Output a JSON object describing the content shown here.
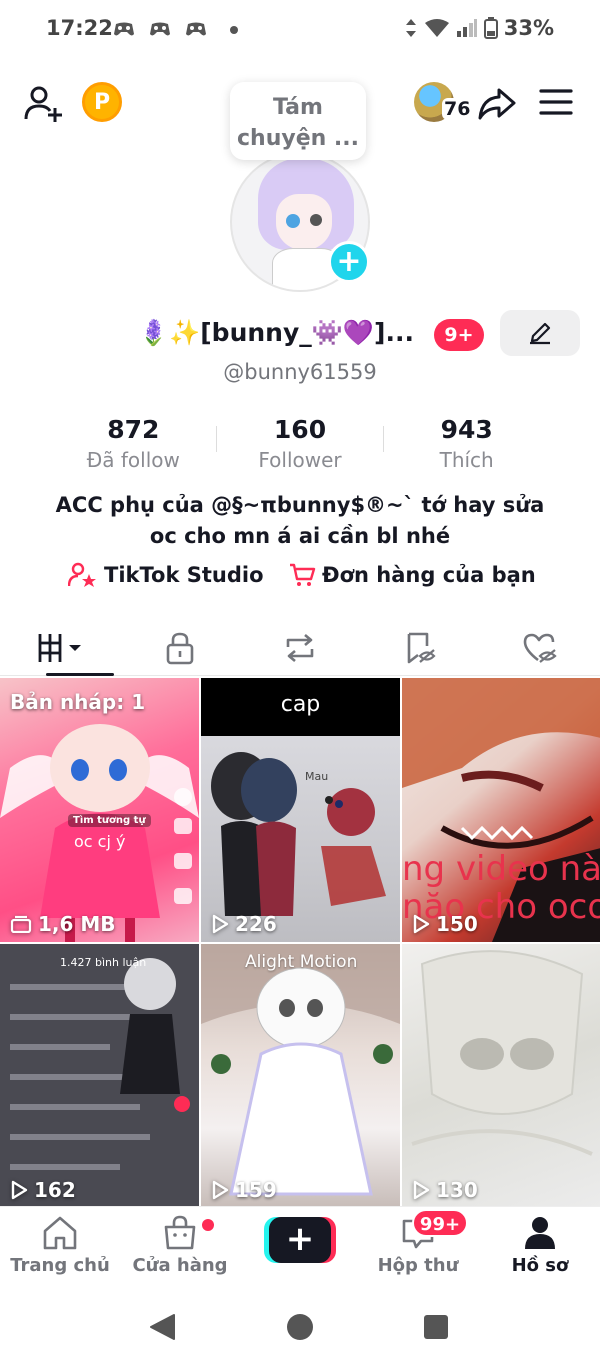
{
  "status_bar": {
    "time": "17:22",
    "battery": "33%"
  },
  "header": {
    "note": "Tám chuyện ...",
    "coin_label": "P",
    "friends_count": "76"
  },
  "profile": {
    "nickname": "🪻✨[bunny_👾💜]...",
    "notification_badge": "9+",
    "username": "@bunny61559",
    "bio": "ACC phụ của @§~πbunny$®~` tớ hay sửa oc cho mn á ai cần bl nhé"
  },
  "stats": [
    {
      "value": "872",
      "label": "Đã follow"
    },
    {
      "value": "160",
      "label": "Follower"
    },
    {
      "value": "943",
      "label": "Thích"
    }
  ],
  "links": {
    "studio": "TikTok Studio",
    "orders": "Đơn hàng của bạn"
  },
  "tabs": [
    {
      "icon": "grid-icon",
      "active": true
    },
    {
      "icon": "lock-icon",
      "active": false
    },
    {
      "icon": "repost-icon",
      "active": false
    },
    {
      "icon": "bookmark-hidden-icon",
      "active": false
    },
    {
      "icon": "liked-hidden-icon",
      "active": false
    }
  ],
  "videos": [
    {
      "top_label": "Bản nháp: 1",
      "bottom_label": "1,6 MB",
      "overlay": "oc cj ý",
      "small_tag": "Tìm tương tự"
    },
    {
      "caption": "cap",
      "bottom_label": "226"
    },
    {
      "bottom_label": "150",
      "overlay": "ng video nà\nnăo cho oco"
    },
    {
      "bottom_label": "162",
      "overlay": "1.427 bình luận"
    },
    {
      "bottom_label": "159",
      "overlay": "Alight Motion"
    },
    {
      "bottom_label": "130"
    }
  ],
  "bottom_nav": {
    "home": "Trang chủ",
    "shop": "Cửa hàng",
    "inbox": "Hộp thư",
    "inbox_badge": "99+",
    "profile": "Hồ sơ"
  },
  "colors": {
    "accent_red": "#fe2c55",
    "accent_cyan": "#25f4ee",
    "text_primary": "#161823",
    "text_secondary": "#73757b"
  }
}
